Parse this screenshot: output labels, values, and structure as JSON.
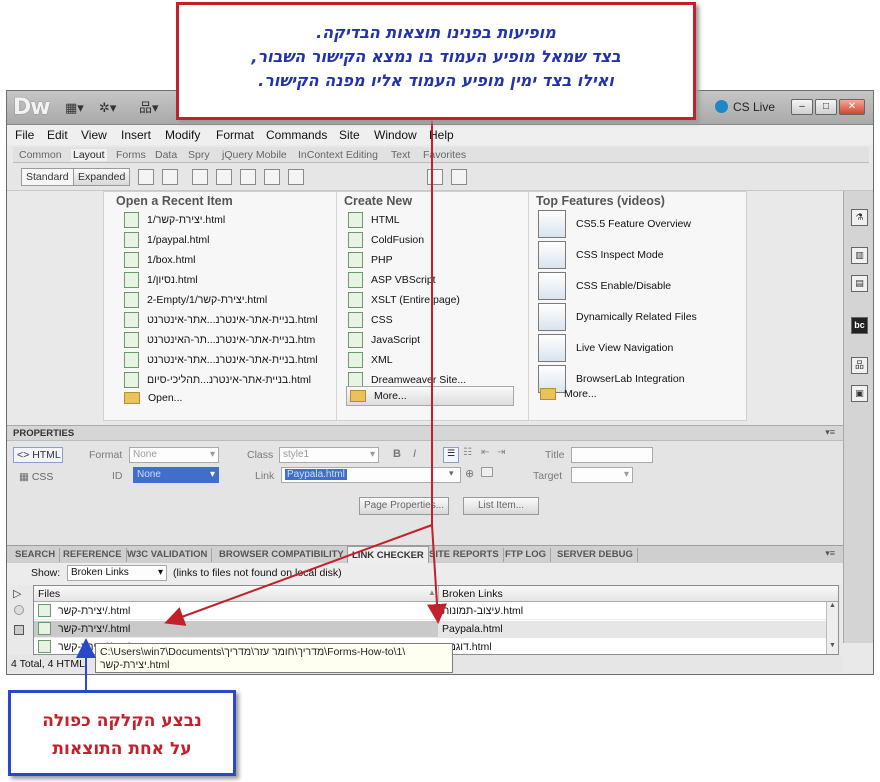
{
  "callout_top": {
    "line1": "מופיעות בפנינו תוצאות הבדיקה.",
    "line2": "בצד שמאל מופיע העמוד בו נמצא הקישור השבור,",
    "line3": "ואילו בצד ימין מופיע העמוד אליו מפנה הקישור."
  },
  "callout_bottom": {
    "line1": "נבצע הקלקה כפולה",
    "line2": "על אחת התוצאות"
  },
  "app": {
    "logo": "Dw",
    "cs_live": "CS Live"
  },
  "menu": [
    "File",
    "Edit",
    "View",
    "Insert",
    "Modify",
    "Format",
    "Commands",
    "Site",
    "Window",
    "Help"
  ],
  "insert_tabs": [
    "Common",
    "Layout",
    "Forms",
    "Data",
    "Spry",
    "jQuery Mobile",
    "InContext Editing",
    "Text",
    "Favorites"
  ],
  "layout_modes": {
    "standard": "Standard",
    "expanded": "Expanded"
  },
  "welcome": {
    "recent_title": "Open a Recent Item",
    "recent_items": [
      "יצירת-קשר/1.html",
      "1/paypal.html",
      "1/box.html",
      "נסיון/1.html",
      "2-Empty/יצירת-קשר/1.html",
      "בניית-אתר-אינטרנ...אתר-אינטרנט.html",
      "בניית-אתר-אינטרנ...תר-האינטרנט.htm",
      "בניית-אתר-אינטרנ...אתר-אינטרנט.html",
      "בניית-אתר-אינטרנ...תהליכי-סיום.html"
    ],
    "recent_open": "Open...",
    "create_title": "Create New",
    "create_items": [
      "HTML",
      "ColdFusion",
      "PHP",
      "ASP VBScript",
      "XSLT (Entire page)",
      "CSS",
      "JavaScript",
      "XML",
      "Dreamweaver Site..."
    ],
    "create_more": "More...",
    "features_title": "Top Features (videos)",
    "features": [
      "CS5.5 Feature Overview",
      "CSS Inspect Mode",
      "CSS Enable/Disable",
      "Dynamically Related Files",
      "Live View Navigation",
      "BrowserLab Integration"
    ],
    "features_more": "More..."
  },
  "properties": {
    "title": "PROPERTIES",
    "html_btn": "HTML",
    "css_btn": "CSS",
    "format_label": "Format",
    "format_value": "None",
    "class_label": "Class",
    "class_value": "style1",
    "id_label": "ID",
    "id_value": "None",
    "link_label": "Link",
    "link_value": "Paypala.html",
    "title_label": "Title",
    "target_label": "Target",
    "bold": "B",
    "italic": "I",
    "page_properties": "Page Properties...",
    "list_item": "List Item..."
  },
  "panel_tabs": [
    "SEARCH",
    "REFERENCE",
    "W3C VALIDATION",
    "BROWSER COMPATIBILITY",
    "LINK CHECKER",
    "SITE REPORTS",
    "FTP LOG",
    "SERVER DEBUG"
  ],
  "link_checker": {
    "show_label": "Show:",
    "show_value": "Broken Links",
    "show_hint": "(links to files not found on local disk)",
    "col_files": "Files",
    "col_broken": "Broken Links",
    "rows": [
      {
        "file": "יצירת-קשר/.html",
        "broken": "עיצוב-תמונות.html"
      },
      {
        "file": "יצירת-קשר/.html",
        "broken": "Paypala.html"
      },
      {
        "file": "יצירת-קשר/.html",
        "broken": "דוגמה.html"
      }
    ],
    "status": "4 Total, 4 HTML",
    "tooltip_line1": "C:\\Users\\win7\\Documents\\מדריך\\חומר עזר\\מדריך\\Forms-How-to\\1\\",
    "tooltip_line2": "יצירת-קשר.html"
  }
}
